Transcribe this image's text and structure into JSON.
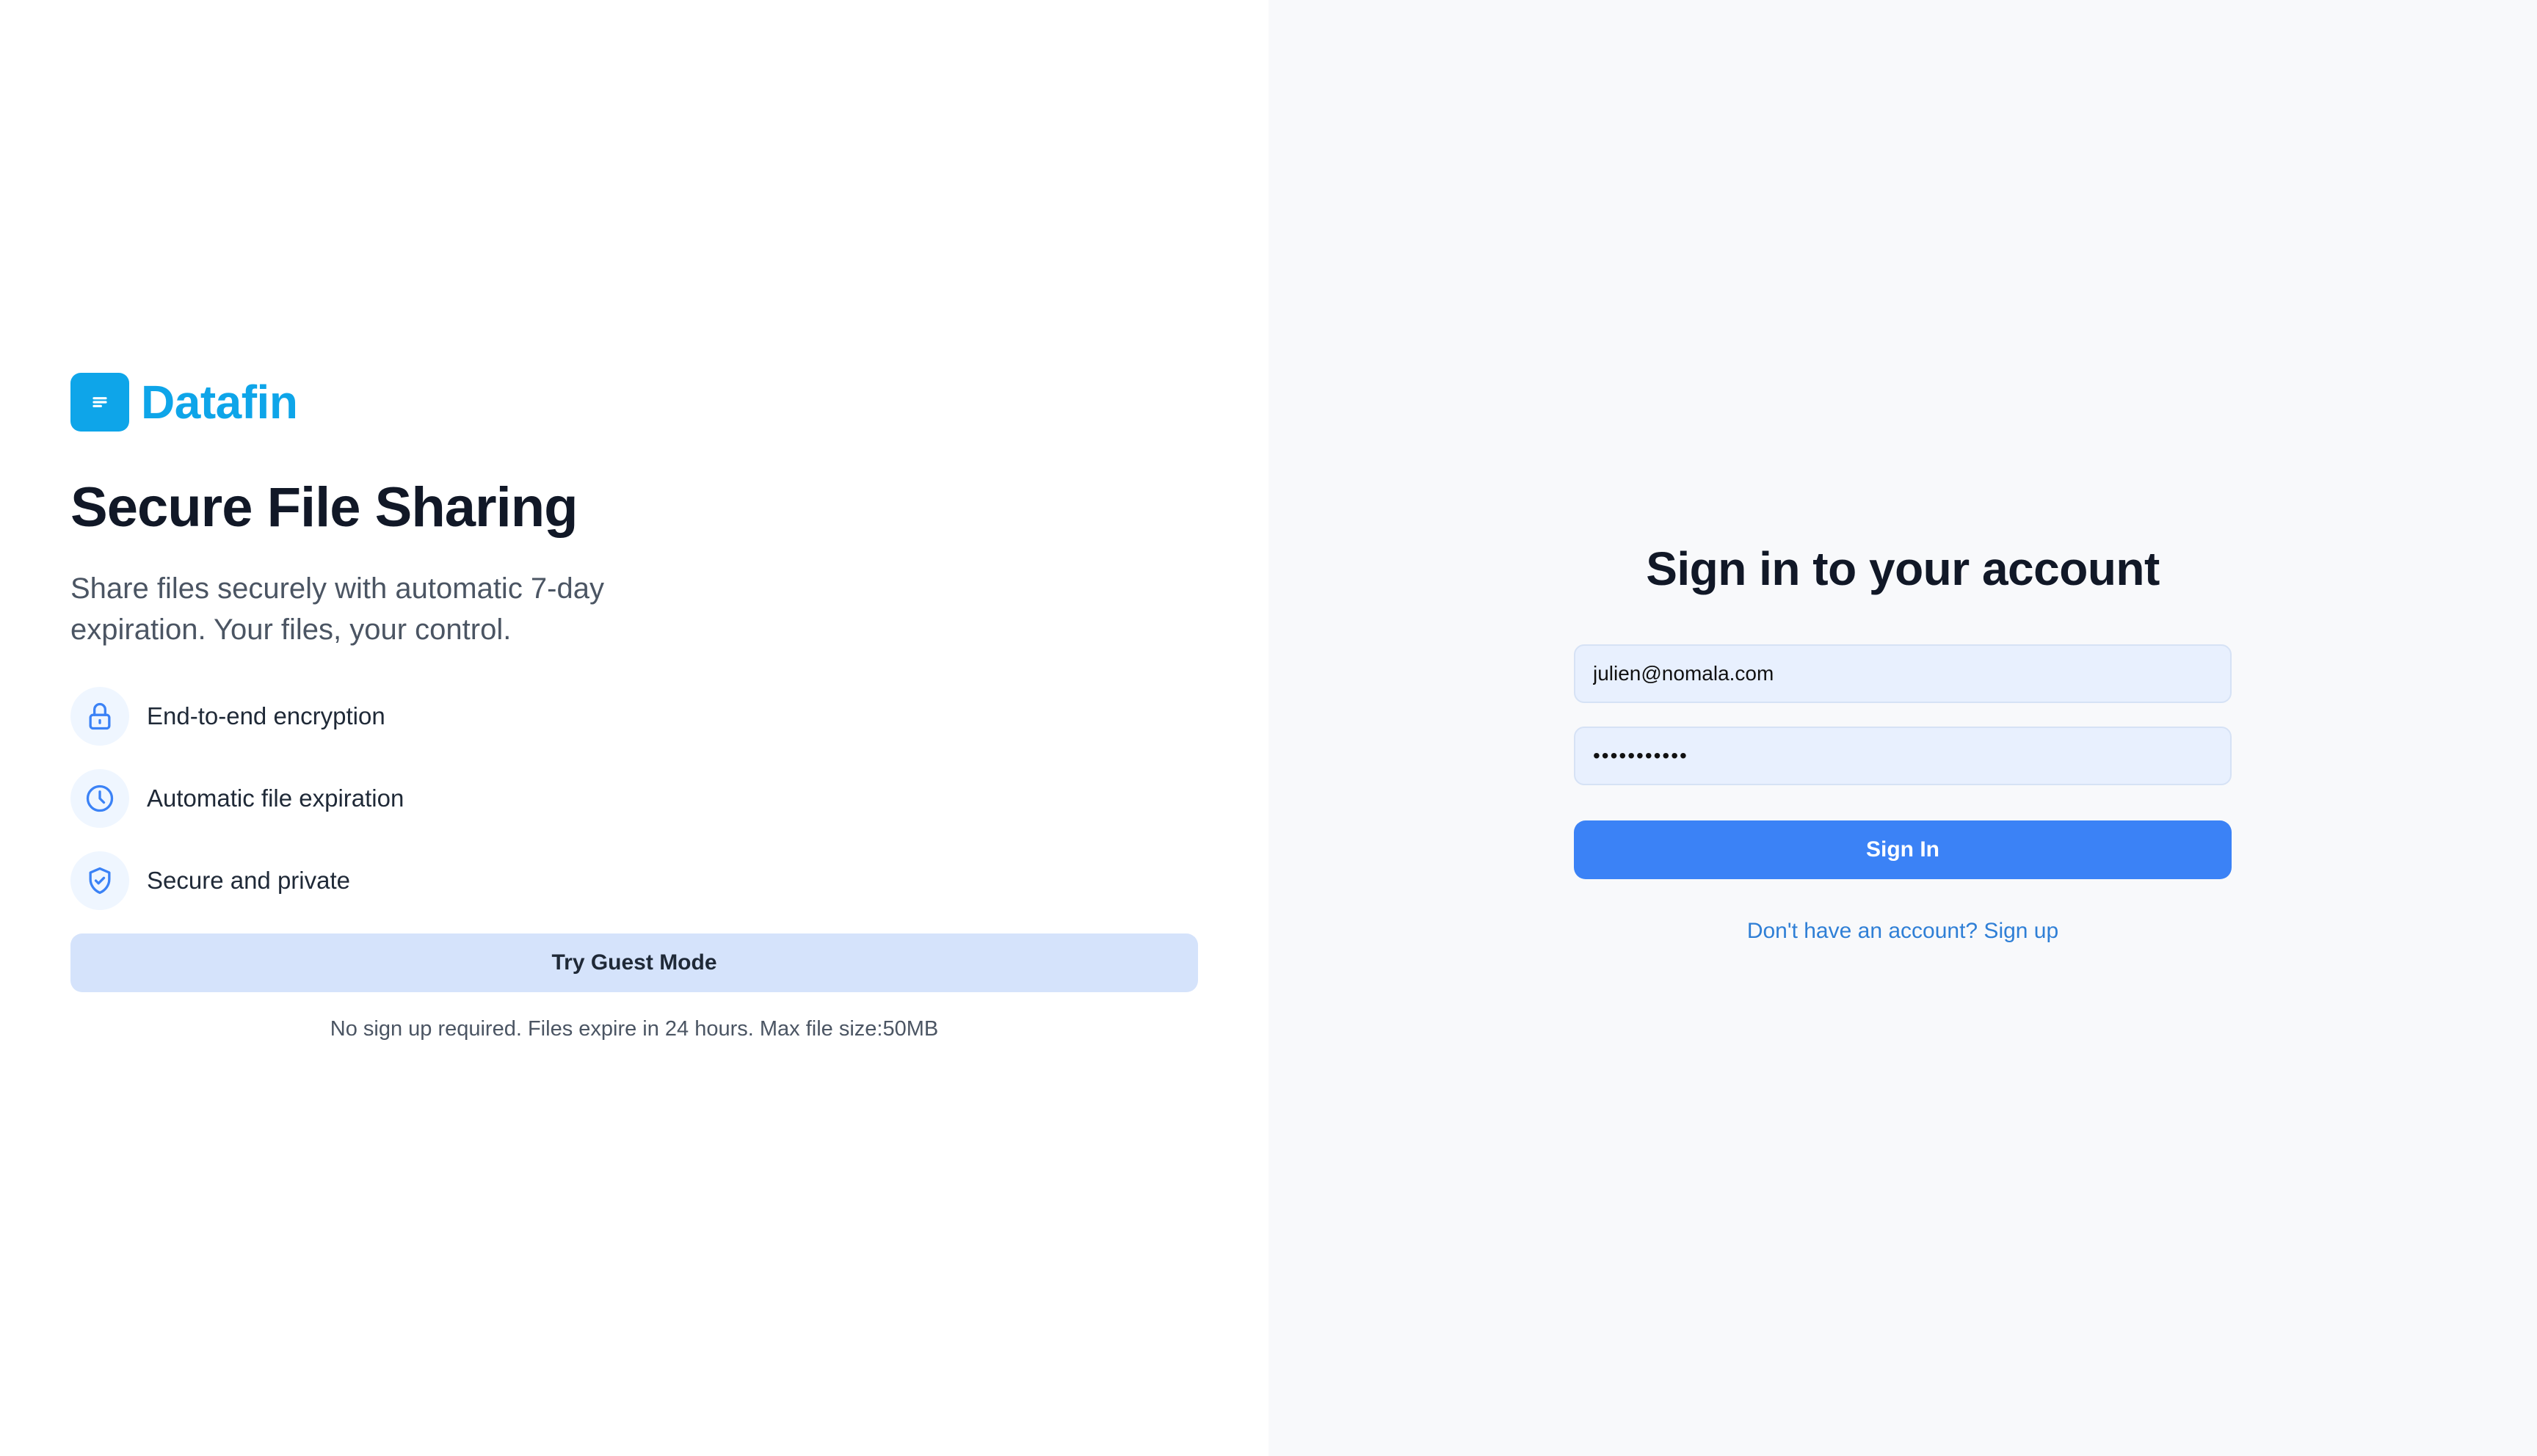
{
  "brand": {
    "name": "Datafin",
    "logo_icon": "document-lines-icon",
    "color": "#0ea5e9"
  },
  "hero": {
    "title": "Secure File Sharing",
    "subtitle": "Share files securely with automatic 7-day expiration. Your files, your control."
  },
  "features": [
    {
      "icon": "lock-icon",
      "label": "End-to-end encryption"
    },
    {
      "icon": "clock-icon",
      "label": "Automatic file expiration"
    },
    {
      "icon": "shield-check-icon",
      "label": "Secure and private"
    }
  ],
  "guest": {
    "button_label": "Try Guest Mode",
    "note": "No sign up required. Files expire in 24 hours. Max file size:50MB"
  },
  "signin": {
    "title": "Sign in to your account",
    "email_value": "julien@nomala.com",
    "password_value": "•••••••••••",
    "button_label": "Sign In",
    "signup_link": "Don't have an account? Sign up"
  },
  "colors": {
    "accent": "#3b82f6",
    "guest_button_bg": "#d5e3fb",
    "right_panel_bg": "#f8f9fb",
    "input_bg": "#e8f0fe"
  }
}
